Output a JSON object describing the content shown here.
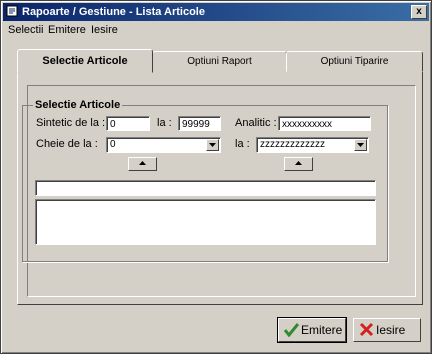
{
  "window": {
    "title": "Rapoarte / Gestiune - Lista Articole",
    "close_label": "x"
  },
  "menu": [
    "Selectii",
    "Emitere",
    "Iesire"
  ],
  "tabs": [
    {
      "label": "Selectie Articole",
      "active": true
    },
    {
      "label": "Optiuni Raport",
      "active": false
    },
    {
      "label": "Optiuni Tiparire",
      "active": false
    }
  ],
  "group": {
    "title": "Selectie Articole",
    "sintetic_label": "Sintetic  de la :",
    "sintetic_from": "0",
    "la_label": "la :",
    "sintetic_to": "99999",
    "analitic_label": "Analitic :",
    "analitic_value": "xxxxxxxxxx",
    "cheie_label": "Cheie  de la :",
    "cheie_from": "0",
    "cheie_la_label": "la :",
    "cheie_to": "zzzzzzzzzzzzz"
  },
  "buttons": {
    "emitere": "Emitere",
    "iesire": "Iesire"
  },
  "colors": {
    "titlebar": "#0a246a",
    "face": "#d4d0c8",
    "emitere_icon": "#2e8b2e",
    "iesire_icon": "#d42020"
  },
  "icons": {
    "app": "report-app-icon",
    "emitere": "checkmark-icon",
    "iesire": "x-mark-icon"
  }
}
